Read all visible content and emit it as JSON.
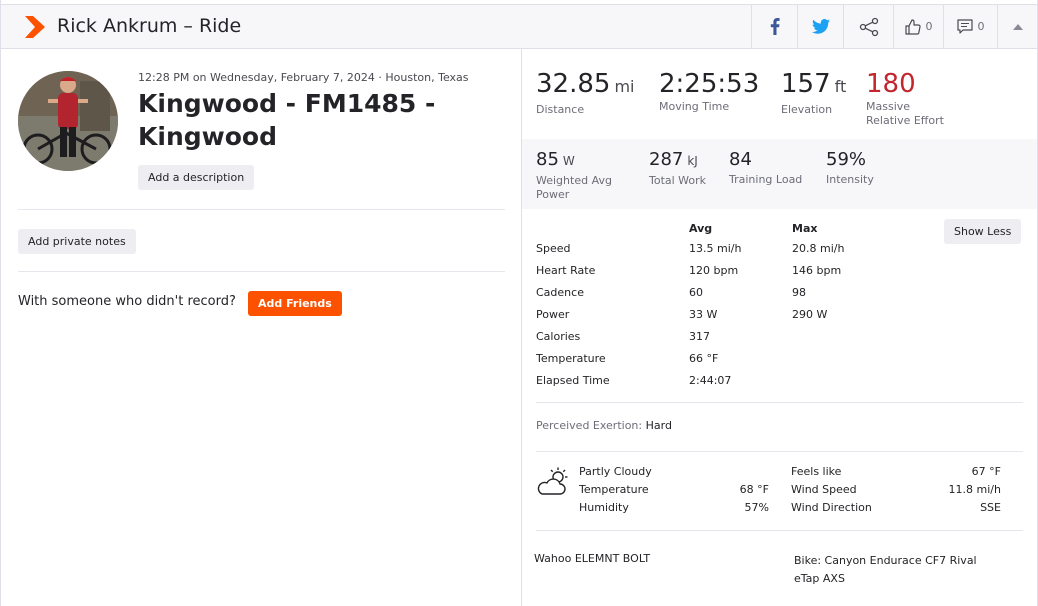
{
  "header": {
    "title": "Rick Ankrum – Ride",
    "kudos_count": "0",
    "comments_count": "0",
    "brand_color": "#fc5200",
    "facebook_color": "#3b5998",
    "twitter_color": "#1da1f2"
  },
  "activity": {
    "meta": "12:28 PM on Wednesday, February 7, 2024 · Houston, Texas",
    "title": "Kingwood - FM1485 - Kingwood",
    "add_description": "Add a description",
    "add_private_notes": "Add private notes",
    "with_someone": "With someone who didn't record?",
    "add_friends": "Add Friends"
  },
  "primary_stats": [
    {
      "value": "32.85",
      "unit": "mi",
      "label": "Distance"
    },
    {
      "value": "2:25:53",
      "unit": "",
      "label": "Moving Time"
    },
    {
      "value": "157",
      "unit": "ft",
      "label": "Elevation"
    },
    {
      "value": "180",
      "unit": "",
      "label_line1": "Massive",
      "label_line2": "Relative Effort"
    }
  ],
  "secondary_stats": [
    {
      "value": "85",
      "unit": "W",
      "label_line1": "Weighted Avg",
      "label_line2": "Power"
    },
    {
      "value": "287",
      "unit": "kJ",
      "label_line1": "Total Work",
      "label_line2": ""
    },
    {
      "value": "84",
      "unit": "",
      "label_line1": "Training Load",
      "label_line2": ""
    },
    {
      "value": "59%",
      "unit": "",
      "label_line1": "Intensity",
      "label_line2": ""
    }
  ],
  "details": {
    "show_less": "Show Less",
    "col_avg": "Avg",
    "col_max": "Max",
    "rows": [
      {
        "label": "Speed",
        "avg": "13.5 mi/h",
        "max": "20.8 mi/h"
      },
      {
        "label": "Heart Rate",
        "avg": "120 bpm",
        "max": "146 bpm"
      },
      {
        "label": "Cadence",
        "avg": "60",
        "max": "98"
      },
      {
        "label": "Power",
        "avg": "33 W",
        "max": "290 W"
      },
      {
        "label": "Calories",
        "avg": "317",
        "max": ""
      },
      {
        "label": "Temperature",
        "avg": "66 °F",
        "max": ""
      },
      {
        "label": "Elapsed Time",
        "avg": "2:44:07",
        "max": ""
      }
    ]
  },
  "exertion": {
    "label": "Perceived Exertion:",
    "value": "Hard"
  },
  "weather": {
    "icon": "partly-cloudy-icon",
    "condition": "Partly Cloudy",
    "temperature_label": "Temperature",
    "temperature_value": "68 °F",
    "humidity_label": "Humidity",
    "humidity_value": "57%",
    "feels_like_label": "Feels like",
    "feels_like_value": "67 °F",
    "wind_speed_label": "Wind Speed",
    "wind_speed_value": "11.8 mi/h",
    "wind_direction_label": "Wind Direction",
    "wind_direction_value": "SSE"
  },
  "gear": {
    "device": "Wahoo ELEMNT BOLT",
    "bike": "Bike: Canyon Endurace CF7 Rival eTap AXS"
  },
  "colors": {
    "relative_effort": "#c2262e"
  }
}
